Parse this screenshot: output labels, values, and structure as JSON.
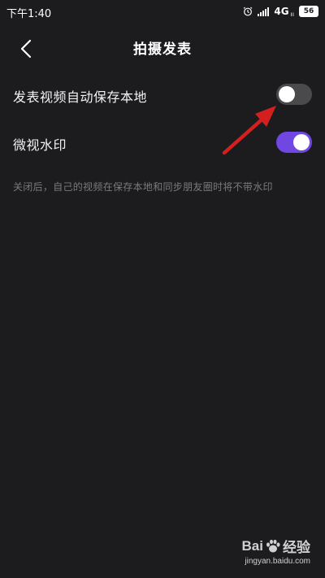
{
  "status_bar": {
    "time": "下午1:40",
    "network": "4G",
    "network_sub": "ıı",
    "battery": "56"
  },
  "header": {
    "title": "拍摄发表"
  },
  "settings": [
    {
      "label": "发表视频自动保存本地",
      "enabled": false
    },
    {
      "label": "微视水印",
      "enabled": true
    }
  ],
  "hint": "关闭后，自己的视频在保存本地和同步朋友圈时将不带水印",
  "watermark": {
    "brand_left": "Bai",
    "brand_right": "经验",
    "url": "jingyan.baidu.com"
  },
  "colors": {
    "background": "#1c1c1e",
    "toggle_on": "#7047e3",
    "toggle_off": "#4a4a4c",
    "annotation": "#d41f1f"
  }
}
